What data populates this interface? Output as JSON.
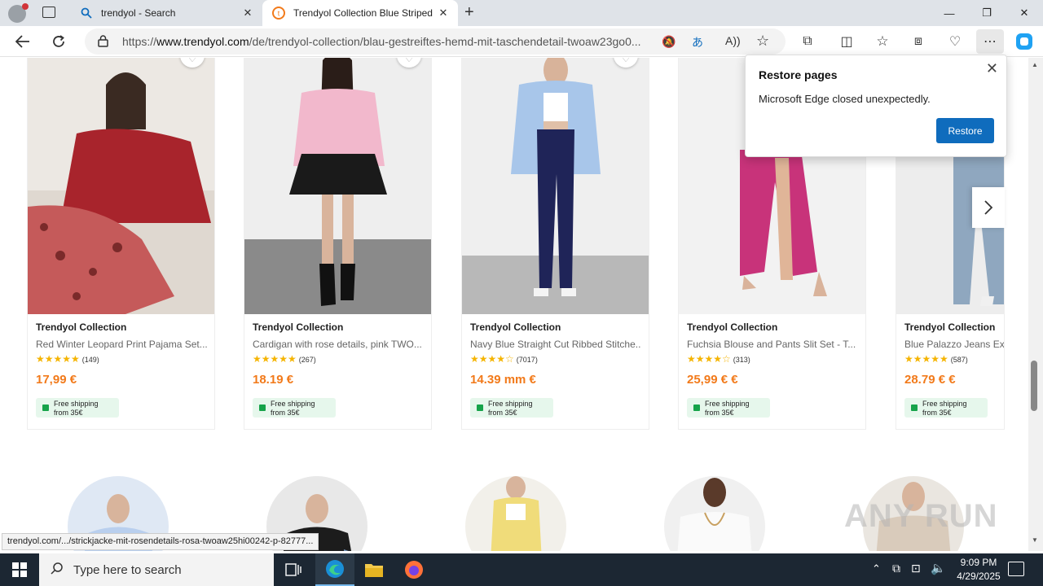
{
  "tabs": [
    {
      "title": "trendyol - Search",
      "icon": "search-icon"
    },
    {
      "title": "Trendyol Collection Blue Striped",
      "icon": "trendyol-logo-icon"
    }
  ],
  "url": {
    "prefix": "https://",
    "domain": "www.trendyol.com",
    "path": "/de/trendyol-collection/blau-gestreiftes-hemd-mit-taschendetail-twoaw23go0..."
  },
  "products": [
    {
      "brand": "Trendyol Collection",
      "name": "Red Winter Leopard Print Pajama Set...",
      "stars": "★★★★★",
      "reviews": "(149)",
      "price": "17,99 €",
      "shipping_line1": "Free shipping",
      "shipping_line2": "from 35€"
    },
    {
      "brand": "Trendyol Collection",
      "name": "Cardigan with rose details, pink TWO...",
      "stars": "★★★★★",
      "reviews": "(267)",
      "price": "18.19 €",
      "shipping_line1": "Free shipping",
      "shipping_line2": "from 35€"
    },
    {
      "brand": "Trendyol Collection",
      "name": "Navy Blue Straight Cut Ribbed Stitche...",
      "stars": "★★★★☆",
      "reviews": "(7017)",
      "price": "14.39 mm €",
      "shipping_line1": "Free shipping",
      "shipping_line2": "from 35€"
    },
    {
      "brand": "Trendyol Collection",
      "name": "Fuchsia Blouse and Pants Slit Set - T...",
      "stars": "★★★★☆",
      "reviews": "(313)",
      "price": "25,99 € €",
      "shipping_line1": "Free shipping",
      "shipping_line2": "from 35€"
    },
    {
      "brand": "Trendyol Collection",
      "name": "Blue Palazzo Jeans Ex",
      "stars": "★★★★★",
      "reviews": "(587)",
      "price": "28.79 € €",
      "shipping_line1": "Free shipping",
      "shipping_line2": "from 35€"
    }
  ],
  "restore_popup": {
    "title": "Restore pages",
    "message": "Microsoft Edge closed unexpectedly.",
    "button": "Restore"
  },
  "status_link": "trendyol.com/.../strickjacke-mit-rosendetails-rosa-twoaw25hi00242-p-82777...",
  "watermark": "ANY RUN",
  "taskbar": {
    "search_placeholder": "Type here to search",
    "time": "9:09 PM",
    "date": "4/29/2025"
  },
  "colors": {
    "accent": "#f27a1a",
    "star": "#f5b400",
    "restore_button": "#0f6cbd",
    "taskbar": "#1c2733"
  }
}
